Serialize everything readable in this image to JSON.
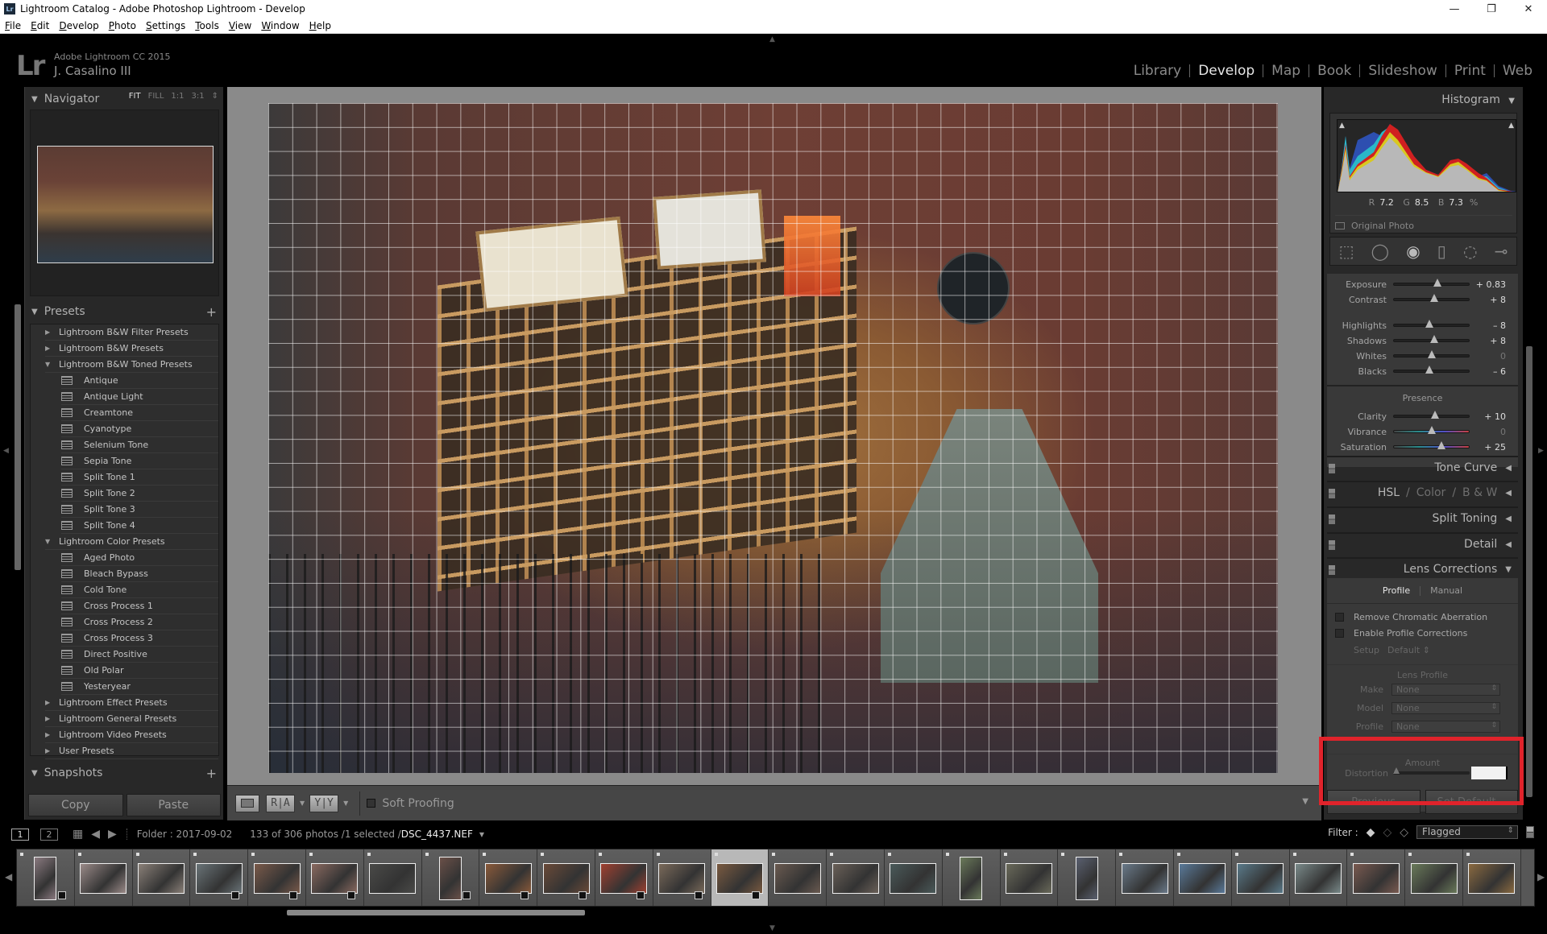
{
  "window": {
    "title": "Lightroom Catalog - Adobe Photoshop Lightroom - Develop",
    "controls": [
      "—",
      "❐",
      "✕"
    ]
  },
  "menu": [
    "File",
    "Edit",
    "Develop",
    "Photo",
    "Settings",
    "Tools",
    "View",
    "Window",
    "Help"
  ],
  "identity": {
    "logo": "Lr",
    "product": "Adobe Lightroom CC 2015",
    "user": "J. Casalino III"
  },
  "modules": [
    {
      "label": "Library",
      "active": false
    },
    {
      "label": "Develop",
      "active": true
    },
    {
      "label": "Map",
      "active": false
    },
    {
      "label": "Book",
      "active": false
    },
    {
      "label": "Slideshow",
      "active": false
    },
    {
      "label": "Print",
      "active": false
    },
    {
      "label": "Web",
      "active": false
    }
  ],
  "navigator": {
    "title": "Navigator",
    "zoom": [
      "FIT",
      "FILL",
      "1:1",
      "3:1"
    ],
    "zoom_selected": "FIT"
  },
  "presets": {
    "title": "Presets",
    "items": [
      {
        "label": "Lightroom B&W Filter Presets",
        "type": "folder",
        "expanded": false
      },
      {
        "label": "Lightroom B&W Presets",
        "type": "folder",
        "expanded": false
      },
      {
        "label": "Lightroom B&W Toned Presets",
        "type": "folder",
        "expanded": true
      },
      {
        "label": "Antique",
        "type": "preset"
      },
      {
        "label": "Antique Light",
        "type": "preset"
      },
      {
        "label": "Creamtone",
        "type": "preset"
      },
      {
        "label": "Cyanotype",
        "type": "preset"
      },
      {
        "label": "Selenium Tone",
        "type": "preset"
      },
      {
        "label": "Sepia Tone",
        "type": "preset"
      },
      {
        "label": "Split Tone 1",
        "type": "preset"
      },
      {
        "label": "Split Tone 2",
        "type": "preset"
      },
      {
        "label": "Split Tone 3",
        "type": "preset"
      },
      {
        "label": "Split Tone 4",
        "type": "preset"
      },
      {
        "label": "Lightroom Color Presets",
        "type": "folder",
        "expanded": true
      },
      {
        "label": "Aged Photo",
        "type": "preset"
      },
      {
        "label": "Bleach Bypass",
        "type": "preset"
      },
      {
        "label": "Cold Tone",
        "type": "preset"
      },
      {
        "label": "Cross Process 1",
        "type": "preset"
      },
      {
        "label": "Cross Process 2",
        "type": "preset"
      },
      {
        "label": "Cross Process 3",
        "type": "preset"
      },
      {
        "label": "Direct Positive",
        "type": "preset"
      },
      {
        "label": "Old Polar",
        "type": "preset"
      },
      {
        "label": "Yesteryear",
        "type": "preset"
      },
      {
        "label": "Lightroom Effect Presets",
        "type": "folder",
        "expanded": false
      },
      {
        "label": "Lightroom General Presets",
        "type": "folder",
        "expanded": false
      },
      {
        "label": "Lightroom Video Presets",
        "type": "folder",
        "expanded": false
      },
      {
        "label": "User Presets",
        "type": "folder",
        "expanded": false
      }
    ]
  },
  "snapshots": {
    "title": "Snapshots"
  },
  "left_buttons": {
    "copy": "Copy",
    "paste": "Paste"
  },
  "toolbar": {
    "before_after_label": "R|A",
    "yy_label": "Y|Y",
    "soft_proofing": "Soft Proofing",
    "soft_proofing_checked": false
  },
  "histogram": {
    "title": "Histogram",
    "r_label": "R",
    "r": "7.2",
    "g_label": "G",
    "g": "8.5",
    "b_label": "B",
    "b": "7.3",
    "unit": "%",
    "original_photo": "Original Photo"
  },
  "tools": [
    "crop-overlay",
    "spot-removal",
    "red-eye",
    "graduated-filter",
    "radial-filter",
    "adjustment-brush"
  ],
  "basic": {
    "sliders": [
      {
        "label": "Exposure",
        "value": "+ 0.83",
        "pos": 0.58
      },
      {
        "label": "Contrast",
        "value": "+ 8",
        "pos": 0.54
      },
      {
        "label": "Highlights",
        "value": "– 8",
        "pos": 0.47
      },
      {
        "label": "Shadows",
        "value": "+ 8",
        "pos": 0.54
      },
      {
        "label": "Whites",
        "value": "0",
        "pos": 0.5
      },
      {
        "label": "Blacks",
        "value": "– 6",
        "pos": 0.47
      }
    ],
    "presence_title": "Presence",
    "presence": [
      {
        "label": "Clarity",
        "value": "+ 10",
        "pos": 0.55
      },
      {
        "label": "Vibrance",
        "value": "0",
        "pos": 0.5
      },
      {
        "label": "Saturation",
        "value": "+ 25",
        "pos": 0.63
      }
    ]
  },
  "sections": {
    "tone_curve": "Tone Curve",
    "hsl": "HSL",
    "color": "Color",
    "bw": "B & W",
    "split_toning": "Split Toning",
    "detail": "Detail",
    "lens_corrections": "Lens Corrections"
  },
  "lens": {
    "tab_profile": "Profile",
    "tab_manual": "Manual",
    "remove_ca": "Remove Chromatic Aberration",
    "enable_profile": "Enable Profile Corrections",
    "setup_label": "Setup",
    "setup_value": "Default",
    "lens_profile_title": "Lens Profile",
    "make_label": "Make",
    "make_value": "None",
    "model_label": "Model",
    "model_value": "None",
    "profile_label": "Profile",
    "profile_value": "None",
    "amount_title": "Amount",
    "distortion_label": "Distortion",
    "distortion_value": ""
  },
  "bottom_buttons": {
    "previous": "Previous",
    "set_default": "Set Default..."
  },
  "highlight_color": "#e0232b",
  "filmstrip": {
    "screen1": "1",
    "screen2": "2",
    "folder": "Folder : 2017-09-02",
    "count": "133 of 306 photos /1 selected /",
    "filename": "DSC_4437.NEF",
    "filter_label": "Filter :",
    "filter_value": "Flagged",
    "thumbs": [
      {
        "c": "#8a7a80",
        "port": true,
        "badge": true
      },
      {
        "c": "#9a8a88"
      },
      {
        "c": "#8a8078"
      },
      {
        "c": "#6a7478",
        "badge": true
      },
      {
        "c": "#7a5a4a",
        "badge": true
      },
      {
        "c": "#8a6a60",
        "badge": true
      },
      {
        "c": "#4a4a48"
      },
      {
        "c": "#6a5048",
        "port": true,
        "badge": true
      },
      {
        "c": "#8a5a3a",
        "badge": true
      },
      {
        "c": "#6a4a38",
        "badge": true
      },
      {
        "c": "#a04030",
        "badge": true
      },
      {
        "c": "#7a6a5a",
        "badge": true
      },
      {
        "c": "#7a5a40",
        "sel": true,
        "badge": true
      },
      {
        "c": "#6a5a50"
      },
      {
        "c": "#6a6058"
      },
      {
        "c": "#4a5a5a"
      },
      {
        "c": "#6a7a5a",
        "port": true
      },
      {
        "c": "#6a6a5a"
      },
      {
        "c": "#5a6070",
        "port": true
      },
      {
        "c": "#6a7a8a"
      },
      {
        "c": "#5a7a9a"
      },
      {
        "c": "#5a7a8a"
      },
      {
        "c": "#7a8a8a"
      },
      {
        "c": "#7a5a50"
      },
      {
        "c": "#6a7a5a"
      },
      {
        "c": "#8a6a40"
      }
    ]
  }
}
